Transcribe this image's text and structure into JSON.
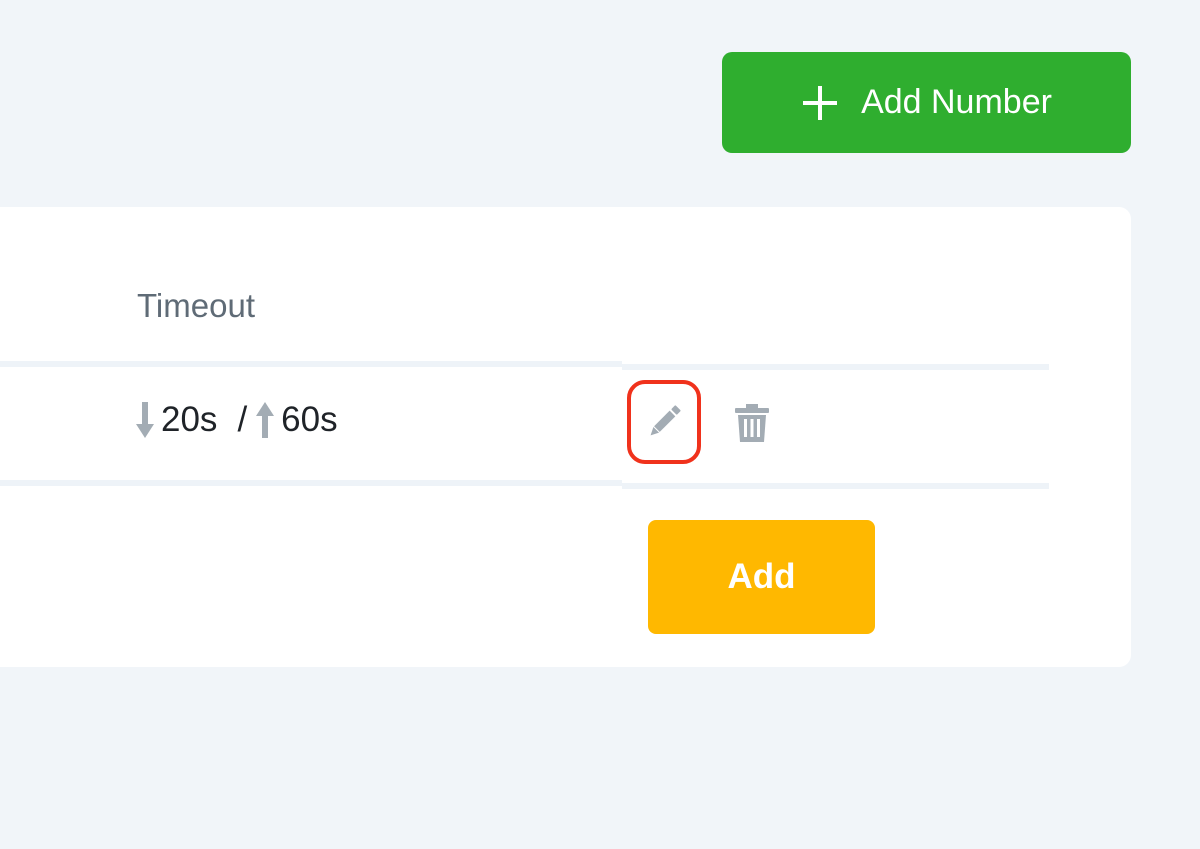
{
  "header": {
    "add_number_label": "Add Number",
    "add_number_icon": "plus-icon"
  },
  "table": {
    "columns": {
      "timeout": "Timeout"
    },
    "rows": [
      {
        "timeout_down": "20s",
        "separator": "/",
        "timeout_up": "60s",
        "icons": {
          "down": "arrow-down-icon",
          "up": "arrow-up-icon",
          "edit": "pencil-icon",
          "delete": "trash-icon"
        }
      }
    ],
    "add_label": "Add"
  },
  "colors": {
    "background": "#f1f5f9",
    "add_number_button": "#2fae2f",
    "add_button": "#ffb800",
    "highlight_ring": "#f0321c",
    "icon_gray": "#a3acb4"
  }
}
